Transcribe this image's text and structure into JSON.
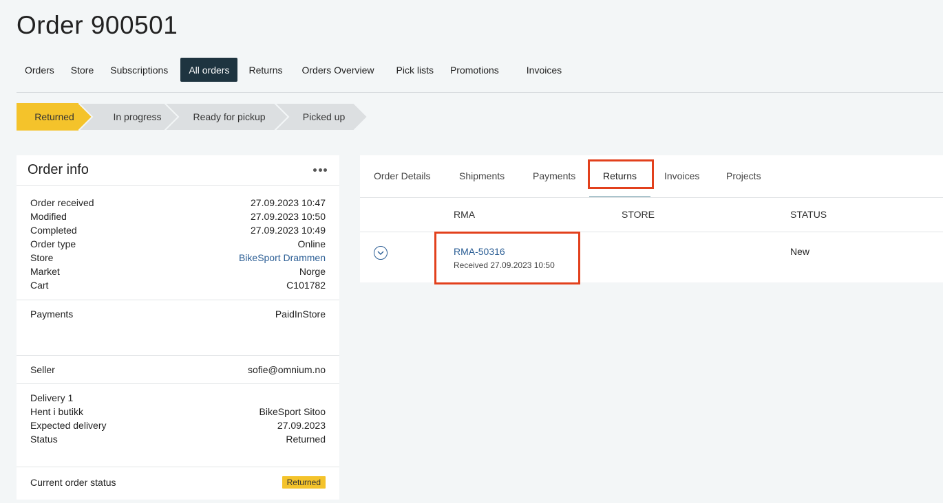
{
  "page": {
    "title": "Order 900501"
  },
  "nav": {
    "items": [
      {
        "label": "Orders"
      },
      {
        "label": "Store"
      },
      {
        "label": "Subscriptions"
      },
      {
        "label": "All orders",
        "active": true
      },
      {
        "label": "Returns"
      },
      {
        "label": "Orders Overview"
      },
      {
        "label": "Pick lists"
      },
      {
        "label": "Promotions"
      },
      {
        "label": "Invoices"
      }
    ]
  },
  "progress": {
    "steps": [
      {
        "label": "Returned",
        "active": true
      },
      {
        "label": "In progress"
      },
      {
        "label": "Ready for pickup"
      },
      {
        "label": "Picked up"
      }
    ]
  },
  "order_info": {
    "title": "Order info",
    "details": [
      {
        "label": "Order received",
        "value": "27.09.2023 10:47"
      },
      {
        "label": "Modified",
        "value": "27.09.2023 10:50"
      },
      {
        "label": "Completed",
        "value": "27.09.2023 10:49"
      },
      {
        "label": "Order type",
        "value": "Online"
      },
      {
        "label": "Store",
        "value": "BikeSport Drammen"
      },
      {
        "label": "Market",
        "value": "Norge"
      },
      {
        "label": "Cart",
        "value": "C101782"
      }
    ],
    "payments": {
      "label": "Payments",
      "value": "PaidInStore"
    },
    "seller": {
      "label": "Seller",
      "value": "sofie@omnium.no"
    },
    "delivery": {
      "title": "Delivery 1",
      "rows": [
        {
          "label": "Hent i butikk",
          "value": "BikeSport Sitoo"
        },
        {
          "label": "Expected delivery",
          "value": "27.09.2023"
        },
        {
          "label": "Status",
          "value": "Returned"
        }
      ]
    },
    "current_status": {
      "label": "Current order status",
      "value": "Returned"
    }
  },
  "details": {
    "tabs": [
      {
        "label": "Order Details"
      },
      {
        "label": "Shipments"
      },
      {
        "label": "Payments"
      },
      {
        "label": "Returns",
        "active": true
      },
      {
        "label": "Invoices"
      },
      {
        "label": "Projects"
      }
    ],
    "columns": {
      "rma": "RMA",
      "store": "STORE",
      "status": "STATUS"
    },
    "rows": [
      {
        "rma": "RMA-50316",
        "received": "Received 27.09.2023 10:50",
        "store": "",
        "status": "New"
      }
    ]
  },
  "colors": {
    "accent_active_nav": "#1e3440",
    "step_active": "#f4c32b",
    "step_inactive": "#dcdfe1",
    "highlight": "#e2401c",
    "link": "#2a5d94"
  }
}
